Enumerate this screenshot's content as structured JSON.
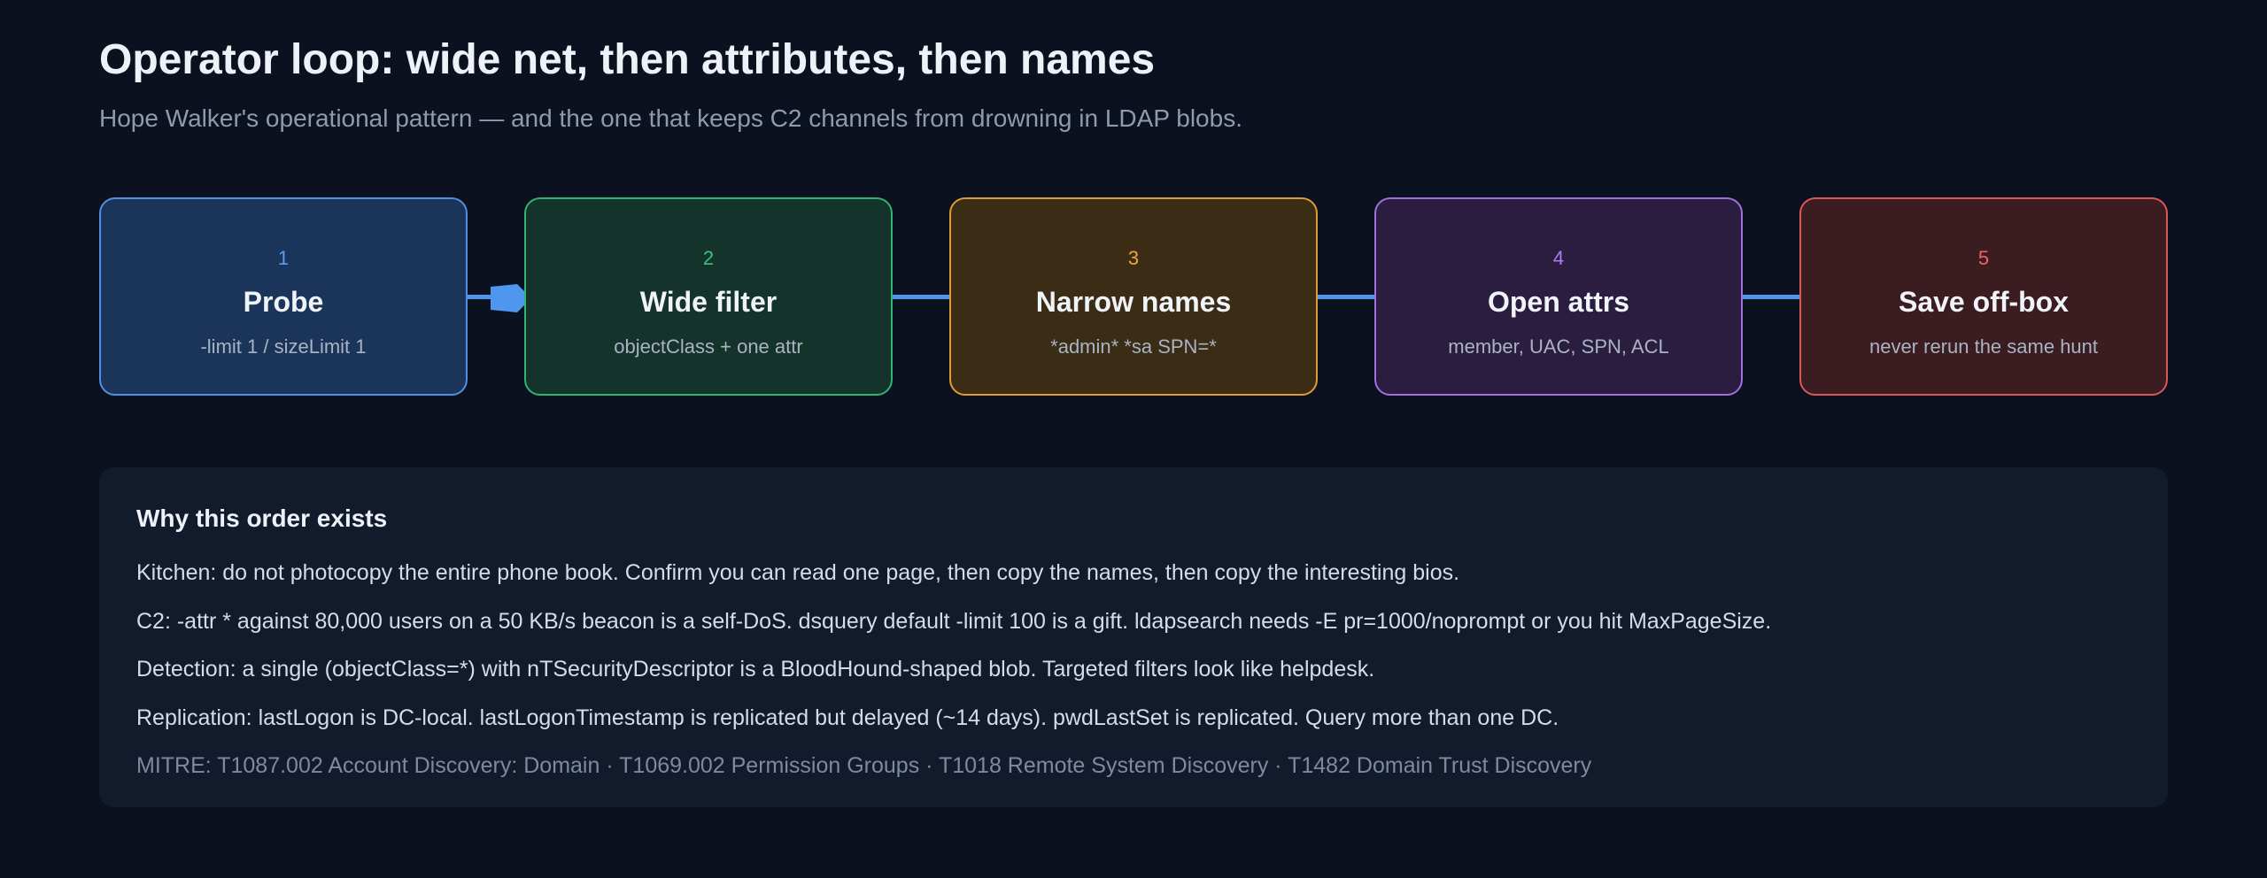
{
  "header": {
    "title": "Operator loop: wide net, then attributes, then names",
    "subtitle": "Hope Walker's operational pattern — and the one that keeps C2 channels from drowning in LDAP blobs."
  },
  "steps": [
    {
      "number": "1",
      "title": "Probe",
      "description": "-limit 1 / sizeLimit 1",
      "accent": "#5b9cf0",
      "fill": "#1b355a",
      "border": "#4f8fe6"
    },
    {
      "number": "2",
      "title": "Wide filter",
      "description": "objectClass + one attr",
      "accent": "#35c47e",
      "fill": "#14332a",
      "border": "#2fb573"
    },
    {
      "number": "3",
      "title": "Narrow names",
      "description": "*admin* *sa SPN=*",
      "accent": "#f0a63a",
      "fill": "#3b2d15",
      "border": "#e09b34"
    },
    {
      "number": "4",
      "title": "Open attrs",
      "description": "member, UAC, SPN, ACL",
      "accent": "#b07cf0",
      "fill": "#2b1d3f",
      "border": "#a070e0"
    },
    {
      "number": "5",
      "title": "Save off-box",
      "description": "never rerun the same hunt",
      "accent": "#ee6464",
      "fill": "#3a1c21",
      "border": "#dc5858"
    }
  ],
  "connector_color": "#4f96ee",
  "notes": {
    "heading": "Why this order exists",
    "lines": [
      "Kitchen: do not photocopy the entire phone book. Confirm you can read one page, then copy the names, then copy the interesting bios.",
      "C2: -attr * against 80,000 users on a 50 KB/s beacon is a self-DoS. dsquery default -limit 100 is a gift. ldapsearch needs -E pr=1000/noprompt or you hit MaxPageSize.",
      "Detection: a single (objectClass=*) with nTSecurityDescriptor is a BloodHound-shaped blob. Targeted filters look like helpdesk.",
      "Replication: lastLogon is DC-local. lastLogonTimestamp is replicated but delayed (~14 days). pwdLastSet is replicated. Query more than one DC."
    ],
    "mitre": "MITRE: T1087.002 Account Discovery: Domain · T1069.002 Permission Groups · T1018 Remote System Discovery · T1482 Domain Trust Discovery"
  }
}
